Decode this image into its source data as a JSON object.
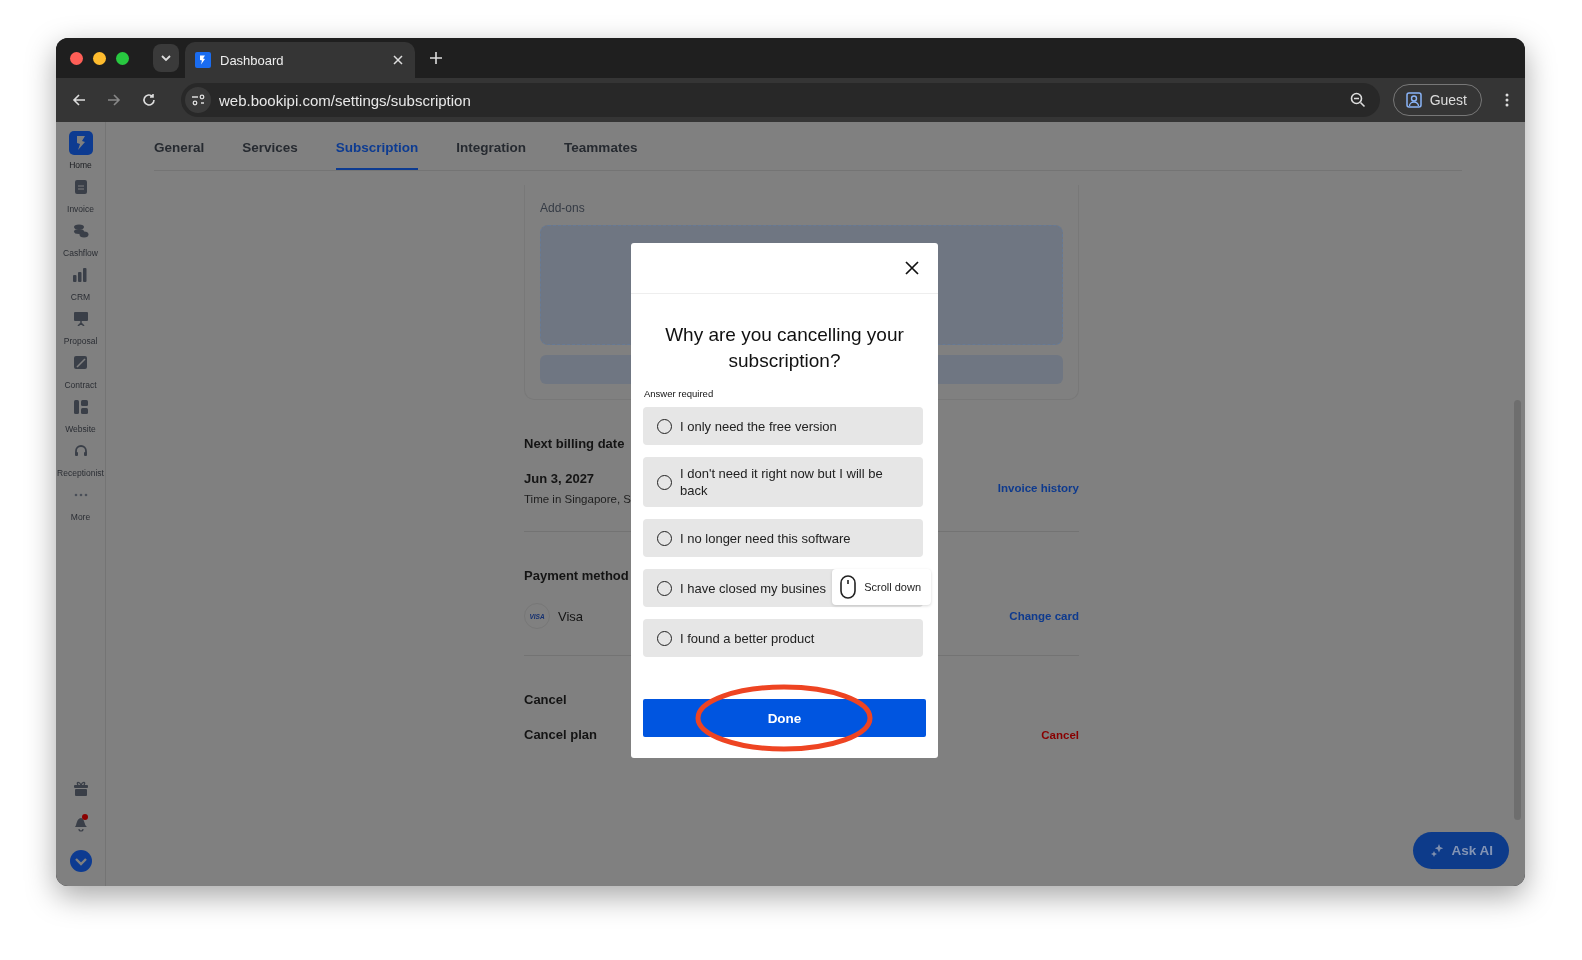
{
  "browser": {
    "tab_title": "Dashboard",
    "address": "web.bookipi.com/settings/subscription",
    "profile": "Guest"
  },
  "sidebar": {
    "items": [
      {
        "label": "Home",
        "selected": true
      },
      {
        "label": "Invoice",
        "selected": false
      },
      {
        "label": "Cashflow",
        "selected": false
      },
      {
        "label": "CRM",
        "selected": false
      },
      {
        "label": "Proposal",
        "selected": false
      },
      {
        "label": "Contract",
        "selected": false
      },
      {
        "label": "Website",
        "selected": false
      },
      {
        "label": "Receptionist",
        "selected": false
      },
      {
        "label": "More",
        "selected": false
      }
    ]
  },
  "tabs": [
    {
      "label": "General",
      "selected": false
    },
    {
      "label": "Services",
      "selected": false
    },
    {
      "label": "Subscription",
      "selected": true
    },
    {
      "label": "Integration",
      "selected": false
    },
    {
      "label": "Teammates",
      "selected": false
    }
  ],
  "addons": {
    "title": "Add-ons"
  },
  "billing": {
    "title": "Next billing date",
    "date": "Jun 3, 2027",
    "timezone": "Time in Singapore, S",
    "link": "Invoice history"
  },
  "payment": {
    "title": "Payment method",
    "card_badge": "VISA",
    "card": "Visa",
    "link": "Change card"
  },
  "cancel": {
    "title": "Cancel",
    "label": "Cancel plan",
    "action": "Cancel"
  },
  "modal": {
    "question": "Why are you cancelling your subscription?",
    "hint": "Answer required",
    "options": [
      {
        "label": "I only need the free version",
        "selected": false
      },
      {
        "label": "I don't need it right now but I will be back",
        "selected": false
      },
      {
        "label": "I no longer need this software",
        "selected": false
      },
      {
        "label": "I have closed my busines",
        "selected": false
      },
      {
        "label": "I found a better product",
        "selected": false
      }
    ],
    "tooltip": "Scroll down",
    "button": "Done"
  },
  "ask_ai": "Ask AI"
}
